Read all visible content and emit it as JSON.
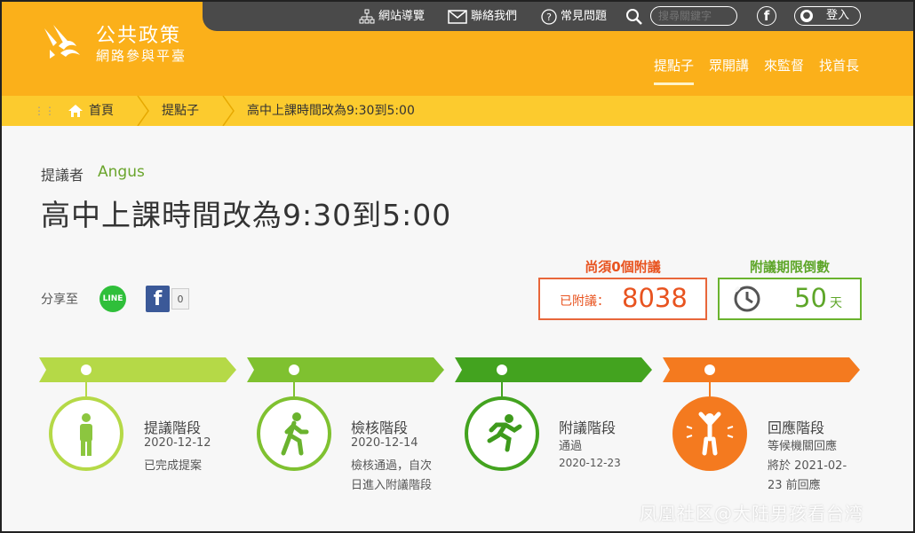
{
  "site": {
    "title": "公共政策",
    "subtitle": "網路參與平臺"
  },
  "topbar": {
    "sitemap": "網站導覽",
    "contact": "聯絡我們",
    "faq": "常見問題",
    "search_placeholder": "搜尋關鍵字",
    "login": "登入"
  },
  "nav": [
    "提點子",
    "眾開講",
    "來監督",
    "找首長"
  ],
  "breadcrumb": [
    "首頁",
    "提點子",
    "高中上課時間改為9:30到5:00"
  ],
  "proposal": {
    "proposer_label": "提議者",
    "proposer": "Angus",
    "title": "高中上課時間改為9:30到5:00",
    "share_label": "分享至",
    "line_text": "LINE",
    "fb_count": "0"
  },
  "stats": {
    "need_label": "尚須0個附議",
    "signed_label": "已附議：",
    "signed_count": "8038",
    "countdown_label": "附議期限倒數",
    "days": "50",
    "days_unit": "天"
  },
  "stages": [
    {
      "name": "提議階段",
      "lines": [
        "2020-12-12",
        "已完成提案"
      ],
      "color": "#8cc63f"
    },
    {
      "name": "檢核階段",
      "lines": [
        "2020-12-14",
        "檢核通過，自次",
        "日進入附議階段"
      ],
      "color": "#6ab32e"
    },
    {
      "name": "附議階段",
      "lines": [
        "通過",
        "2020-12-23"
      ],
      "color": "#3e9a1c"
    },
    {
      "name": "回應階段",
      "lines": [
        "等候機關回應",
        "將於  2021-02-",
        "23  前回應"
      ],
      "color": "#f47a1f"
    }
  ],
  "watermark": "凤凰社区@大陆男孩看台湾",
  "colors": {
    "header": "#fbb01a",
    "breadcrumb": "#fccb2e",
    "accent_orange": "#e8531f",
    "accent_green": "#5ea629"
  }
}
